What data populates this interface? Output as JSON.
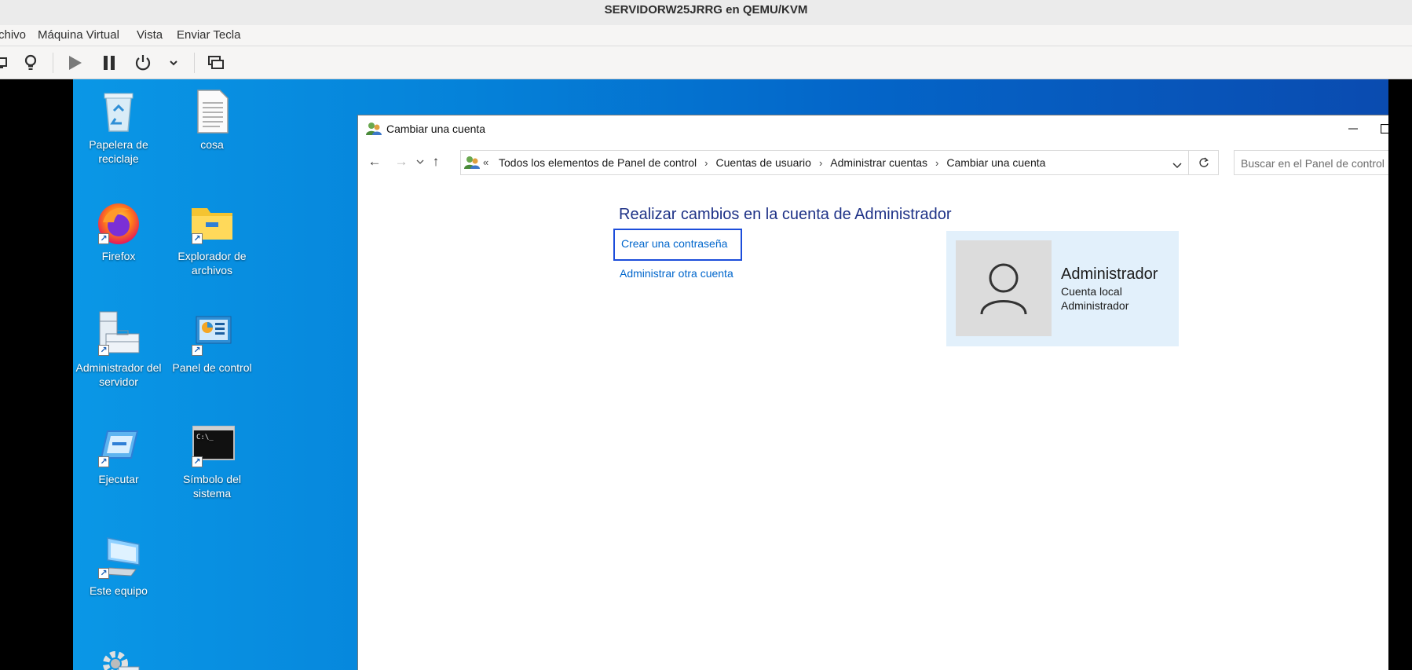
{
  "host": {
    "title": "SERVIDORW25JRRG en QEMU/KVM",
    "menu": [
      "chivo",
      "Máquina Virtual",
      "Vista",
      "Enviar Tecla"
    ],
    "toolbar_icons": [
      "display-icon",
      "lightbulb-icon",
      "play-icon",
      "pause-icon",
      "power-icon",
      "chevron-down-icon",
      "screens-icon"
    ]
  },
  "desktop": {
    "icons": [
      {
        "label": "Papelera de reciclaje",
        "icon": "recycle-bin-icon"
      },
      {
        "label": "cosa",
        "icon": "text-file-icon"
      },
      {
        "label": "Firefox",
        "icon": "firefox-icon"
      },
      {
        "label": "Explorador de archivos",
        "icon": "folder-icon"
      },
      {
        "label": "Administrador del servidor",
        "icon": "server-manager-icon"
      },
      {
        "label": "Panel de control",
        "icon": "control-panel-icon"
      },
      {
        "label": "Ejecutar",
        "icon": "run-icon"
      },
      {
        "label": "Símbolo del sistema",
        "icon": "cmd-icon"
      },
      {
        "label": "Este equipo",
        "icon": "computer-icon"
      },
      {
        "label": "",
        "icon": "gear-icon"
      }
    ]
  },
  "window": {
    "title": "Cambiar una cuenta",
    "breadcrumb": [
      "Todos los elementos de Panel de control",
      "Cuentas de usuario",
      "Administrar cuentas",
      "Cambiar una cuenta"
    ],
    "search_placeholder": "Buscar en el Panel de control",
    "heading": "Realizar cambios en la cuenta de Administrador",
    "links": {
      "create_password": "Crear una contraseña",
      "manage_other": "Administrar otra cuenta"
    },
    "account": {
      "name": "Administrador",
      "type": "Cuenta local",
      "role": "Administrador"
    }
  }
}
